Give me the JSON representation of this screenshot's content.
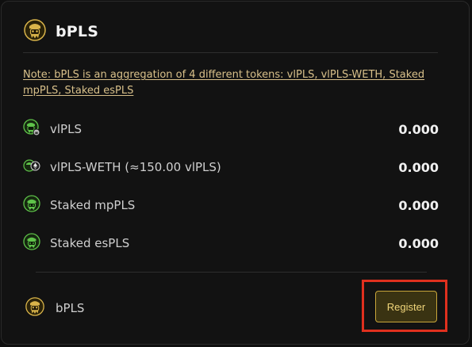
{
  "header": {
    "title": "bPLS",
    "icon": "bpls-gold-icon"
  },
  "note": "Note: bPLS is an aggregation of 4 different tokens: vlPLS, vlPLS-WETH, Staked mpPLS, Staked esPLS",
  "tokens": [
    {
      "label": "vlPLS",
      "value": "0.000",
      "icon": "vlpls-icon"
    },
    {
      "label": "vlPLS-WETH (≈150.00 vlPLS)",
      "value": "0.000",
      "icon": "vlpls-weth-icon"
    },
    {
      "label": "Staked mpPLS",
      "value": "0.000",
      "icon": "mppls-icon"
    },
    {
      "label": "Staked esPLS",
      "value": "0.000",
      "icon": "espls-icon"
    }
  ],
  "footer": {
    "label": "bPLS",
    "icon": "bpls-gold-icon",
    "register_label": "Register"
  },
  "colors": {
    "accent_gold": "#d9b44a",
    "token_green": "#5fc34a",
    "highlight_red": "#e0301e"
  }
}
